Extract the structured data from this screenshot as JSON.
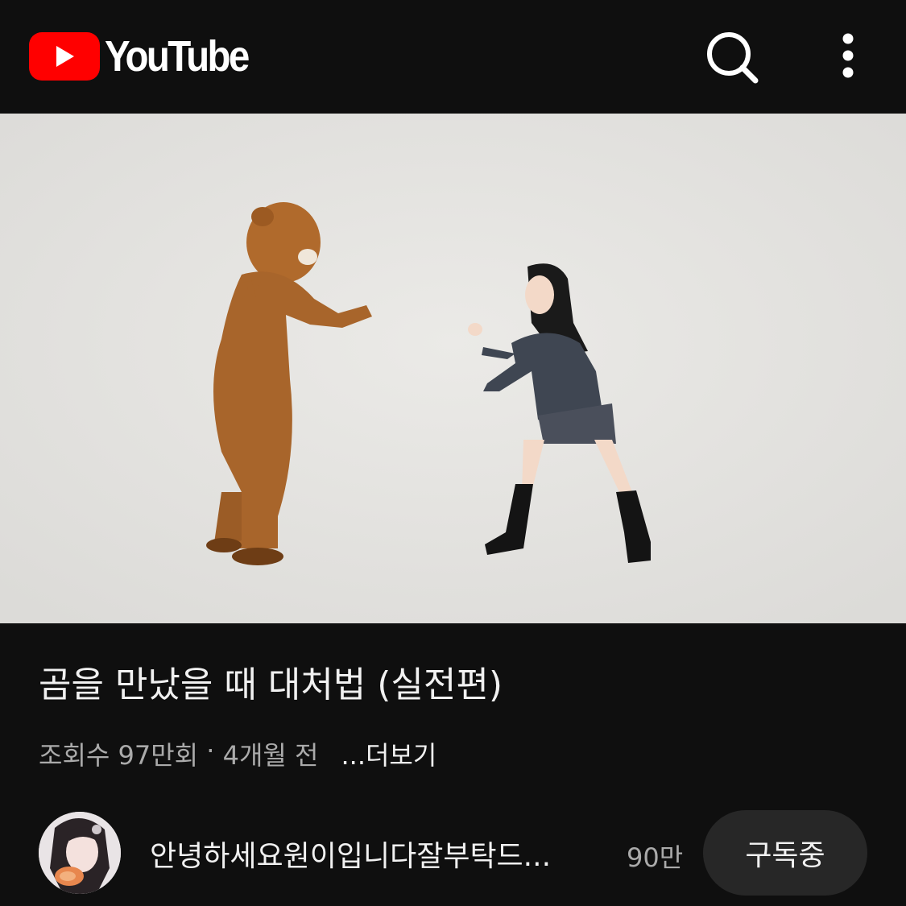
{
  "header": {
    "logo_text": "YouTube",
    "logo_icon": "youtube-play-icon",
    "search_icon": "search-icon",
    "more_icon": "more-vert-icon"
  },
  "video": {
    "title": "곰을 만났을 때 대처법 (실전편)",
    "views": "조회수 97만회",
    "separator": " · ",
    "age": "4개월 전",
    "more_label": "...더보기"
  },
  "channel": {
    "name": "안녕하세요원이입니다잘부탁드...",
    "subscribers": "90만",
    "subscribe_label": "구독중"
  },
  "colors": {
    "background": "#0f0f0f",
    "brand_red": "#ff0000",
    "secondary_text": "#aaaaaa",
    "button_bg": "#272727"
  }
}
